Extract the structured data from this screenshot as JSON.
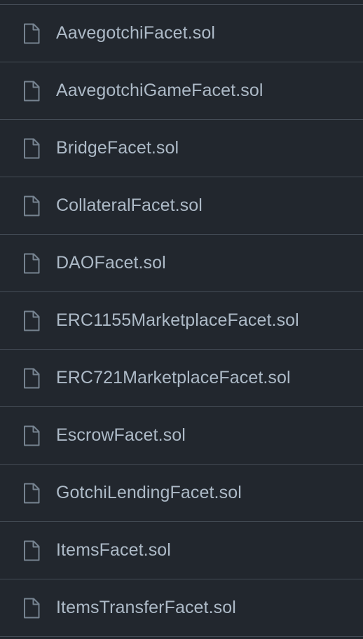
{
  "files": [
    {
      "name": "AavegotchiFacet.sol",
      "icon": "file-icon"
    },
    {
      "name": "AavegotchiGameFacet.sol",
      "icon": "file-icon"
    },
    {
      "name": "BridgeFacet.sol",
      "icon": "file-icon"
    },
    {
      "name": "CollateralFacet.sol",
      "icon": "file-icon"
    },
    {
      "name": "DAOFacet.sol",
      "icon": "file-icon"
    },
    {
      "name": "ERC1155MarketplaceFacet.sol",
      "icon": "file-icon"
    },
    {
      "name": "ERC721MarketplaceFacet.sol",
      "icon": "file-icon"
    },
    {
      "name": "EscrowFacet.sol",
      "icon": "file-icon"
    },
    {
      "name": "GotchiLendingFacet.sol",
      "icon": "file-icon"
    },
    {
      "name": "ItemsFacet.sol",
      "icon": "file-icon"
    },
    {
      "name": "ItemsTransferFacet.sol",
      "icon": "file-icon"
    }
  ],
  "colors": {
    "background": "#22272e",
    "divider": "#444c56",
    "text": "#adbac7",
    "icon": "#768390"
  }
}
